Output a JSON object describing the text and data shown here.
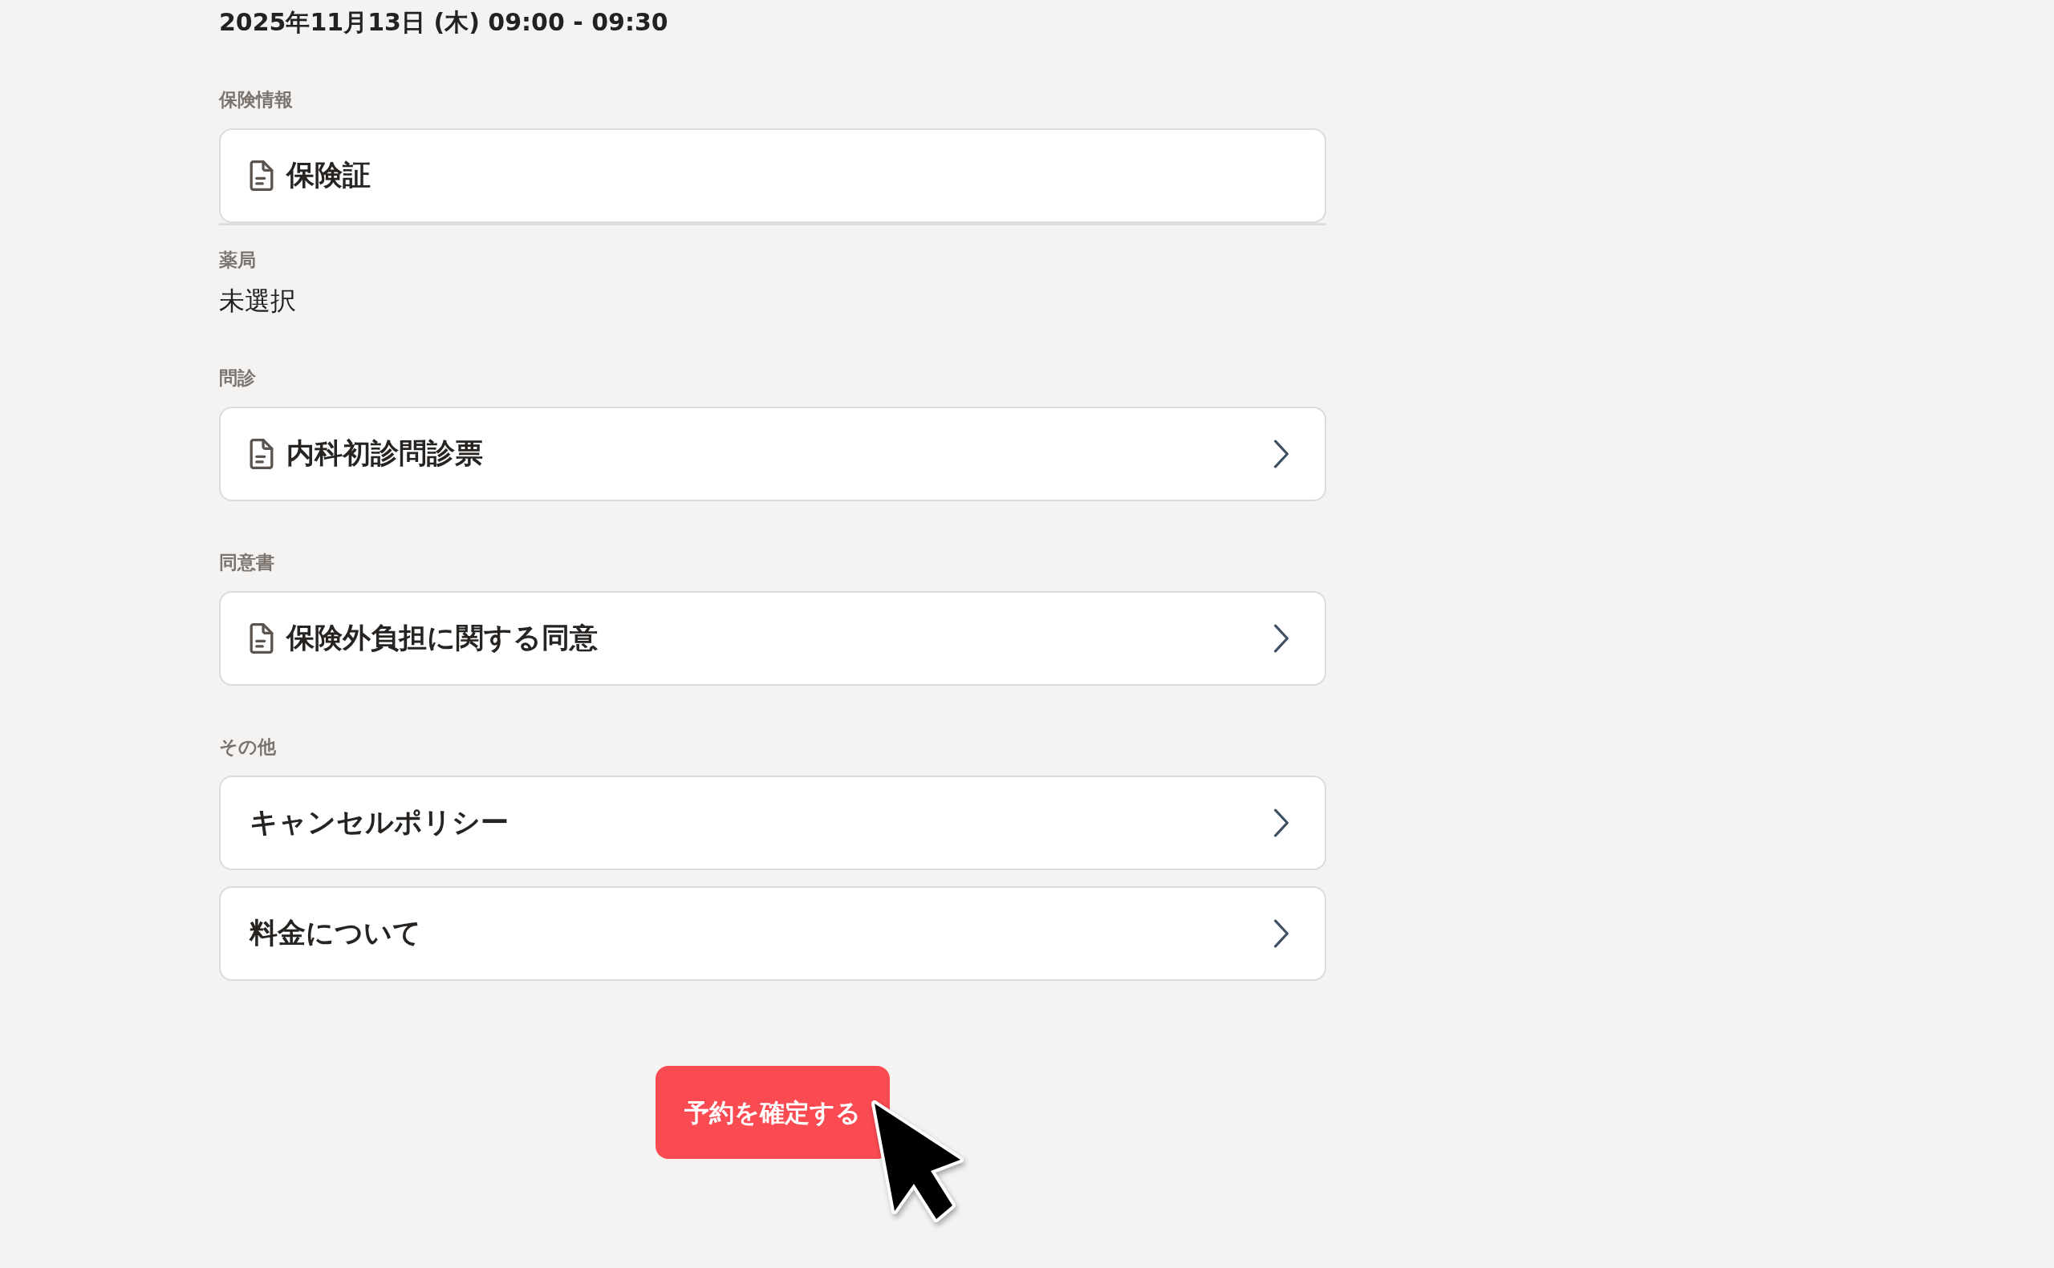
{
  "header": {
    "datetime": "2025年11月13日 (木) 09:00 - 09:30"
  },
  "sections": [
    {
      "kind": "cards",
      "label": "保険情報",
      "divider": true,
      "items": [
        {
          "kind": "document",
          "title": "保険証",
          "navigable": false
        }
      ]
    },
    {
      "kind": "text",
      "label": "薬局",
      "value": "未選択"
    },
    {
      "kind": "cards",
      "label": "問診",
      "divider": false,
      "items": [
        {
          "kind": "document",
          "title": "内科初診問診票",
          "navigable": true
        }
      ]
    },
    {
      "kind": "cards",
      "label": "同意書",
      "divider": false,
      "items": [
        {
          "kind": "document",
          "title": "保険外負担に関する同意",
          "navigable": true
        }
      ]
    },
    {
      "kind": "cards",
      "label": "その他",
      "divider": false,
      "items": [
        {
          "kind": "plain",
          "title": "キャンセルポリシー",
          "navigable": true
        },
        {
          "kind": "plain",
          "title": "料金について",
          "navigable": true
        }
      ]
    }
  ],
  "confirm_button": {
    "label": "予約を確定する"
  }
}
